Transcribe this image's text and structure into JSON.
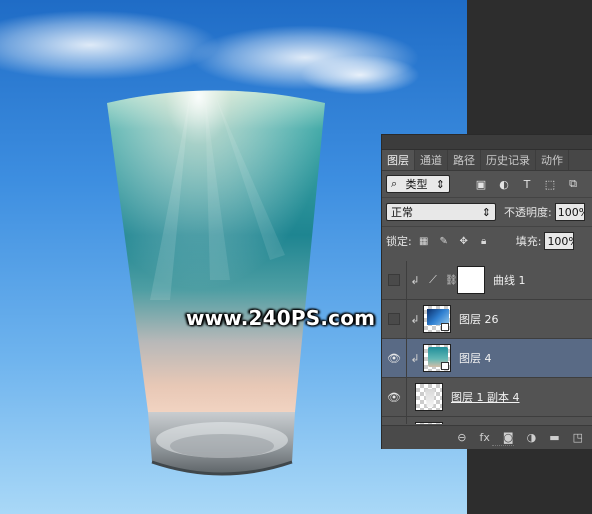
{
  "watermark": "www.240PS.com",
  "panel": {
    "tabs": [
      "图层",
      "通道",
      "路径",
      "历史记录",
      "动作"
    ],
    "kind_filter": "类型",
    "blend_mode": "正常",
    "opacity_label": "不透明度:",
    "opacity_value": "100%",
    "lock_label": "锁定:",
    "fill_label": "填充:",
    "fill_value": "100%",
    "layers": [
      {
        "name": "曲线 1",
        "visible": false,
        "selected": false
      },
      {
        "name": "图层 26",
        "visible": false,
        "selected": false
      },
      {
        "name": "图层 4",
        "visible": true,
        "selected": true
      },
      {
        "name": "图层 1 副本 4",
        "visible": true,
        "selected": false
      }
    ],
    "footer_icons": [
      "link-icon",
      "fx-icon",
      "mask-icon",
      "adjustment-icon",
      "folder-icon",
      "new-layer-icon"
    ],
    "filter_icons": [
      "image-icon",
      "adjustment-filter-icon",
      "type-icon",
      "shape-icon",
      "smart-object-icon"
    ],
    "lock_icons": [
      "lock-pixels-icon",
      "lock-paint-icon",
      "lock-position-icon",
      "lock-all-icon"
    ]
  },
  "colors": {
    "panel_bg": "#535353",
    "selected_layer": "#596a85",
    "sky_top": "#1f6cc6",
    "sky_bottom": "#a9d8f7"
  }
}
